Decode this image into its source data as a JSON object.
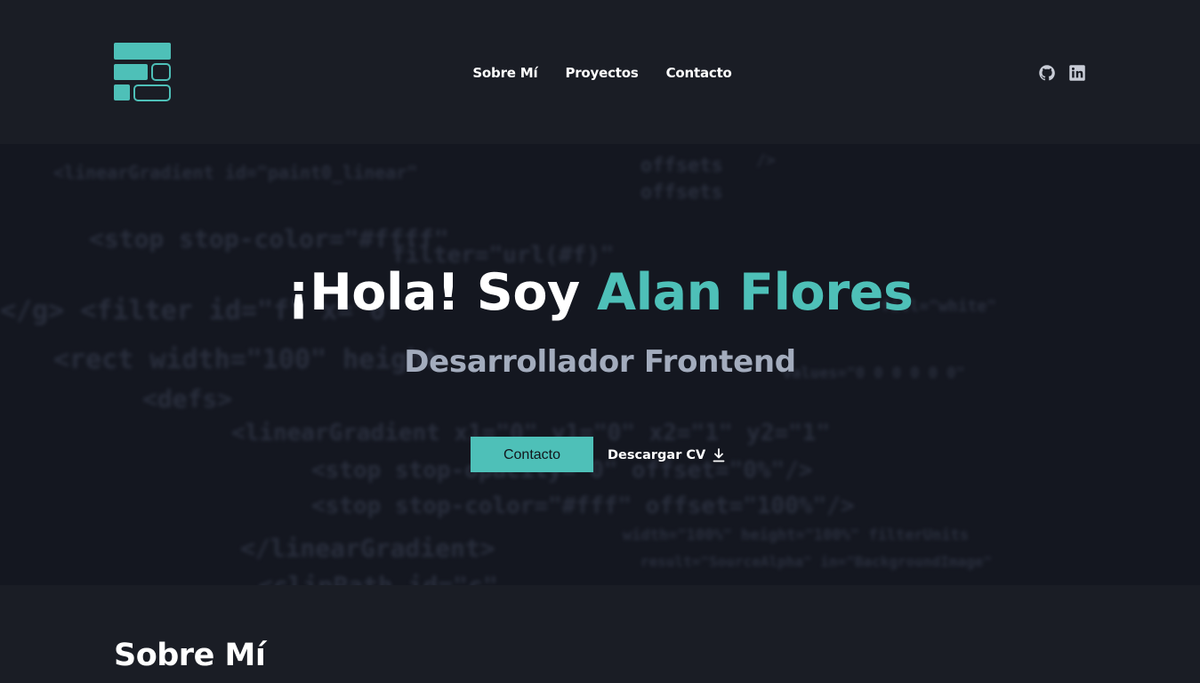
{
  "brand": {
    "logo_icon": "block-grid-logo-icon",
    "accent_color": "#4ec0b8"
  },
  "nav": {
    "items": [
      {
        "label": "Sobre Mí"
      },
      {
        "label": "Proyectos"
      },
      {
        "label": "Contacto"
      }
    ]
  },
  "socials": {
    "github_icon": "github-icon",
    "linkedin_icon": "linkedin-icon"
  },
  "hero": {
    "greeting": "¡Hola! Soy ",
    "name": "Alan Flores",
    "subtitle": "Desarrollador Frontend",
    "contact_button": "Contacto",
    "cv_button": "Descargar CV",
    "cv_icon": "download-icon"
  },
  "about": {
    "title": "Sobre Mí"
  },
  "colors": {
    "background": "#1a1d25",
    "hero_background": "#141720",
    "subtitle": "#a3acbd"
  }
}
